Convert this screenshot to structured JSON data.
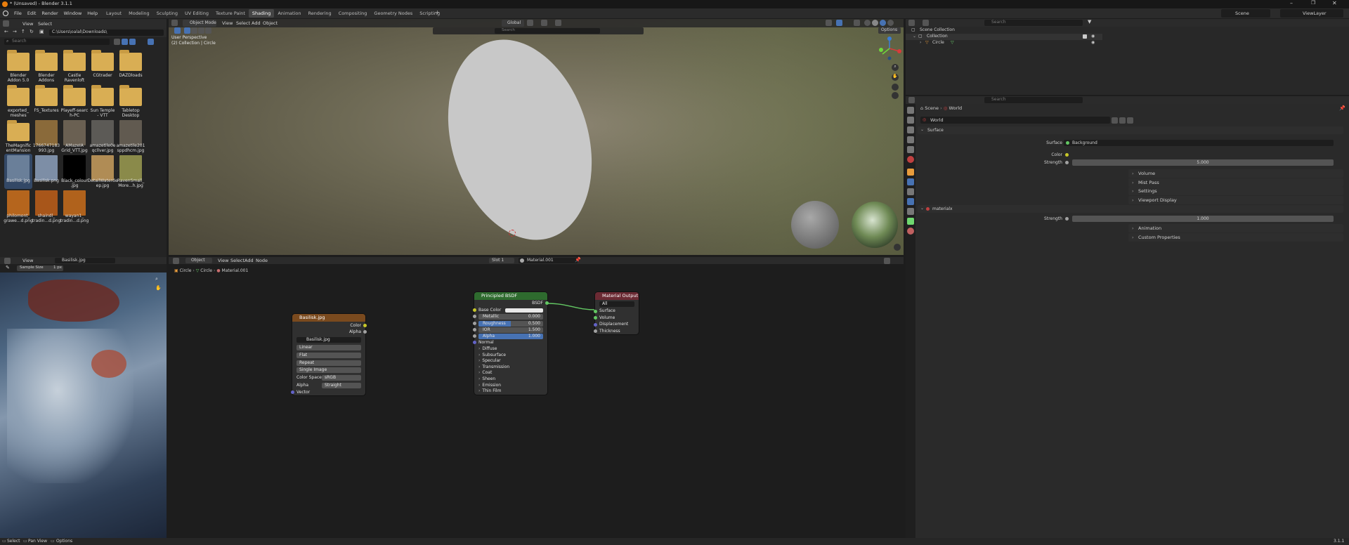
{
  "titlebar": {
    "title": "* (Unsaved) - Blender 3.1.1"
  },
  "topbar": {
    "menus": [
      "File",
      "Edit",
      "Render",
      "Window",
      "Help"
    ],
    "workspaces": [
      "Layout",
      "Modeling",
      "Sculpting",
      "UV Editing",
      "Texture Paint",
      "Shading",
      "Animation",
      "Rendering",
      "Compositing",
      "Geometry Nodes",
      "Scripting"
    ],
    "active_workspace": "Shading",
    "scene": "Scene",
    "view_layer": "ViewLayer"
  },
  "file_browser": {
    "menus": [
      "View",
      "Select"
    ],
    "path": "C:\\Users\\oalal\\Downloads\\",
    "search_placeholder": "Search",
    "items": [
      {
        "name": "Blender\nAddon 5.0",
        "type": "folder"
      },
      {
        "name": "Blender\nAddons",
        "type": "folder"
      },
      {
        "name": "Castle\nRavenloft",
        "type": "folder"
      },
      {
        "name": "CGtrader",
        "type": "folder"
      },
      {
        "name": "DAZDloads",
        "type": "folder"
      },
      {
        "name": "exported_\nmeshes",
        "type": "folder"
      },
      {
        "name": "FS_Textures",
        "type": "folder"
      },
      {
        "name": "Playeff-searc\nh-PC",
        "type": "folder"
      },
      {
        "name": "Sun Temple\n- VTT",
        "type": "folder"
      },
      {
        "name": "Tabletop\nDesktop",
        "type": "folder"
      },
      {
        "name": "TheMagnific\nentMansion",
        "type": "folder"
      },
      {
        "name": "1766747183\n993.jpg",
        "type": "image",
        "color": "#8a6a3a"
      },
      {
        "name": "AMazeIA\nGrid_VTT.jpg",
        "type": "image",
        "color": "#6a6052"
      },
      {
        "name": "amazetile0e\nqcllver.jpg",
        "type": "image",
        "color": "#5c5a56"
      },
      {
        "name": "amazetile201\nsppdhcm.jpg",
        "type": "image",
        "color": "#615a50"
      },
      {
        "name": "Basilisk.jpg",
        "type": "image",
        "color": "#6a7f99",
        "selected": true
      },
      {
        "name": "Basilisk.png",
        "type": "image",
        "color": "#7d8ea6"
      },
      {
        "name": "Black_colour\n.jpg",
        "type": "image",
        "color": "#000000"
      },
      {
        "name": "DetailWaterde\nep.jpg",
        "type": "image",
        "color": "#b08c55"
      },
      {
        "name": "RavenSmall_\nMore...h.jpg",
        "type": "image",
        "color": "#8a8a4a"
      },
      {
        "name": "philomont_\ngrawe...d.png",
        "type": "image",
        "color": "#b5651d"
      },
      {
        "name": "shaindl_\ntradin...d.png",
        "type": "image",
        "color": "#a8561a"
      },
      {
        "name": "wayan1_\ntradin...d.png",
        "type": "image",
        "color": "#b0621c"
      }
    ]
  },
  "viewport": {
    "mode": "Object Mode",
    "menus": [
      "View",
      "Select",
      "Add",
      "Object"
    ],
    "transform": "Global",
    "title_line1": "User Perspective",
    "title_line2": "(2) Collection | Circle",
    "options": "Options",
    "search_placeholder": "Search"
  },
  "image_editor": {
    "menus": [
      "View"
    ],
    "image_name": "Basilisk.jpg",
    "sample_label": "Sample Size",
    "sample_value": "1 px"
  },
  "node_editor": {
    "object_type": "Object",
    "menus": [
      "View",
      "Select",
      "Add",
      "Node"
    ],
    "slot": "Slot 1",
    "material": "Material.001",
    "breadcrumb": [
      "Circle",
      "Circle",
      "Material.001"
    ],
    "image_node": {
      "title": "Basilisk.jpg",
      "outputs": [
        "Color",
        "Alpha"
      ],
      "image": "Basilisk.jpg",
      "interpolation": "Linear",
      "projection": "Flat",
      "extension": "Repeat",
      "source": "Single Image",
      "color_space_label": "Color Space",
      "color_space": "sRGB",
      "alpha_label": "Alpha",
      "alpha_value": "Straight",
      "input": "Vector"
    },
    "bsdf_node": {
      "title": "Principled BSDF",
      "output": "BSDF",
      "base_color": "Base Color",
      "metallic_label": "Metallic",
      "metallic": "0.000",
      "roughness_label": "Roughness",
      "roughness": "0.500",
      "roughness_fill": 0.5,
      "ior_label": "IOR",
      "ior": "1.500",
      "alpha_label": "Alpha",
      "alpha": "1.000",
      "alpha_fill": 1.0,
      "normal": "Normal",
      "panels": [
        "Diffuse",
        "Subsurface",
        "Specular",
        "Transmission",
        "Coat",
        "Sheen",
        "Emission",
        "Thin Film"
      ]
    },
    "output_node": {
      "title": "Material Output",
      "target": "All",
      "inputs": [
        "Surface",
        "Volume",
        "Displacement",
        "Thickness"
      ]
    }
  },
  "outliner": {
    "search_placeholder": "Search",
    "scene_collection": "Scene Collection",
    "collection": "Collection",
    "object": "Circle"
  },
  "properties": {
    "search_placeholder": "Search",
    "breadcrumb": [
      "Scene",
      "World"
    ],
    "world_name": "World",
    "surface_header": "Surface",
    "surface_label": "Surface",
    "surface_value": "Background",
    "color_label": "Color",
    "strength_label": "Strength",
    "strength_value": "5.000",
    "panels": [
      "Volume",
      "Mist Pass",
      "Settings",
      "Viewport Display"
    ],
    "materialx": "materialx",
    "materialx_strength_label": "Strength",
    "materialx_strength": "1.000",
    "bottom_panels": [
      "Animation",
      "Custom Properties"
    ]
  },
  "statusbar": {
    "items": [
      "Select",
      "Pan View",
      "Options"
    ],
    "version": "3.1.1"
  },
  "colors": {
    "accent_blue": "#4772b3",
    "image_node_header": "#7a4a1e",
    "bsdf_header": "#2e6b2e",
    "output_header": "#6b2a33",
    "socket_yellow": "#c7c729",
    "socket_green": "#63c763",
    "socket_gray": "#a1a1a1",
    "socket_blue": "#6363c7",
    "world_icon": "#c04040"
  }
}
